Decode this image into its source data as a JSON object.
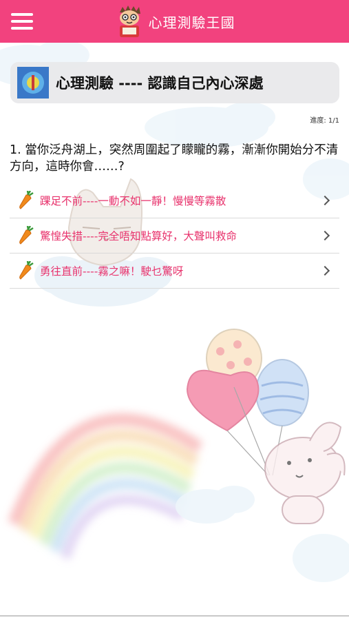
{
  "header": {
    "app_title": "心理測驗王國"
  },
  "test": {
    "title": "心理測驗 ---- 認識自己內心深處",
    "progress": "進度: 1/1"
  },
  "question": {
    "text": "1. 當你泛舟湖上，突然周圍起了矇矓的霧，漸漸你開始分不清方向，這時你會……?"
  },
  "options": [
    {
      "label": "踝足不前----一動不如一靜！慢慢等霧散",
      "icon": "carrot-icon"
    },
    {
      "label": "驚惶失措----完全唔知點算好，大聲叫救命",
      "icon": "carrot-icon"
    },
    {
      "label": "勇往直前----霧之嘛！駛乜驚呀",
      "icon": "carrot-icon"
    }
  ],
  "colors": {
    "header": "#f2427e",
    "option_text": "#e8336d",
    "card": "#e8e8ea"
  }
}
